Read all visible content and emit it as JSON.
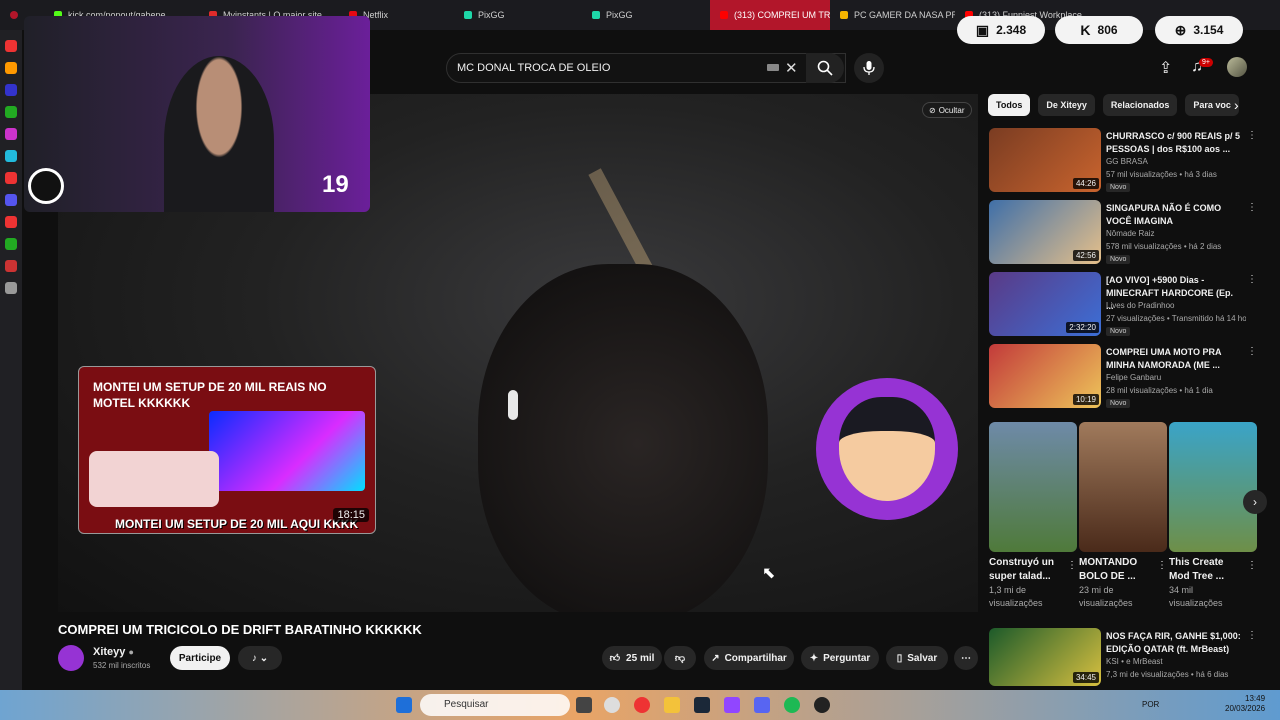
{
  "browser_tabs": [
    {
      "label": "kick.com/popout/gabepe",
      "color": "#53fc18"
    },
    {
      "label": "Myinstants | O maior site...",
      "color": "#e02b2b"
    },
    {
      "label": "Netflix",
      "color": "#e50914"
    },
    {
      "label": "PixGG",
      "color": "#1ed7a8"
    },
    {
      "label": "PixGG",
      "color": "#1ed7a8"
    },
    {
      "label": "(313) COMPREI UM TRICI",
      "color": "#ff0000"
    },
    {
      "label": "PC GAMER DA NASA PRE",
      "color": "#f5b400"
    },
    {
      "label": "(313) Funniest Workplace",
      "color": "#ff0000"
    }
  ],
  "stats": {
    "twitch_viewers": "2.348",
    "kick_viewers": "806",
    "web_viewers": "3.154"
  },
  "search": {
    "query": "MC DONAL TROCA DE OLEIO"
  },
  "notifications_badge": "9+",
  "player": {
    "hide_label": "Ocultar",
    "webcam_overlay_number": "19",
    "card_title": "MONTEI UM SETUP DE 20 MIL REAIS NO MOTEL KKKKKK",
    "card_caption": "MONTEI UM SETUP DE 20 MIL AQUI KKKK",
    "card_duration": "18:15"
  },
  "video": {
    "title": "COMPREI UM TRICICOLO DE DRIFT BARATINHO KKKKKK",
    "channel": "Xiteyy",
    "subscribers": "532 mil inscritos",
    "join_label": "Participe",
    "likes": "25 mil",
    "share_label": "Compartilhar",
    "ask_label": "Perguntar",
    "save_label": "Salvar"
  },
  "chips": [
    "Todos",
    "De Xiteyy",
    "Relacionados",
    "Para voc"
  ],
  "recommendations": [
    {
      "title": "CHURRASCO c/ 900 REAIS p/ 5 PESSOAS | dos R$100 aos ...",
      "channel": "GG BRASA",
      "meta": "57 mil visualizações • há 3 dias",
      "duration": "44:26",
      "tag": "Novo",
      "thumb": "#7a3c22"
    },
    {
      "title": "SINGAPURA NÃO É COMO VOCÊ IMAGINA",
      "channel": "Nômade Raiz",
      "meta": "578 mil visualizações • há 2 dias",
      "duration": "42:56",
      "tag": "Novo",
      "thumb": "#3f6fa8"
    },
    {
      "title": "[AO VIVO] +5900 Dias - MINECRAFT HARDCORE (Ep. ...",
      "channel": "Lives do Pradinhoo",
      "meta": "27 visualizações • Transmitido há 14 hor",
      "duration": "2:32:20",
      "tag": "Novo",
      "thumb": "#5a3a86"
    },
    {
      "title": "COMPREI UMA MOTO PRA MINHA NAMORADA (ME ...",
      "channel": "Felipe Ganbaru",
      "meta": "28 mil visualizações • há 1 dia",
      "duration": "10:19",
      "tag": "Novo",
      "thumb": "#c23a3a"
    }
  ],
  "shorts": [
    {
      "title": "Construyó un super talad...",
      "views": "1,3 mi de visualizações",
      "thumb": "#6e8aa8"
    },
    {
      "title": "MONTANDO BOLO DE ...",
      "views": "23 mi de visualizações",
      "thumb": "#5a3524"
    },
    {
      "title": "This Create Mod Tree ...",
      "views": "34 mil visualizações",
      "thumb": "#6e8f48"
    }
  ],
  "bottom_rec": {
    "title": "NOS FAÇA RIR, GANHE $1,000: EDIÇÃO QATAR (ft. MrBeast)",
    "channel": "KSI • e MrBeast",
    "meta": "7,3 mi de visualizações • há 6 dias",
    "duration": "34:45"
  },
  "taskbar": {
    "search_placeholder": "Pesquisar",
    "lang": "POR",
    "time": "13:49",
    "date": "20/03/2026"
  }
}
